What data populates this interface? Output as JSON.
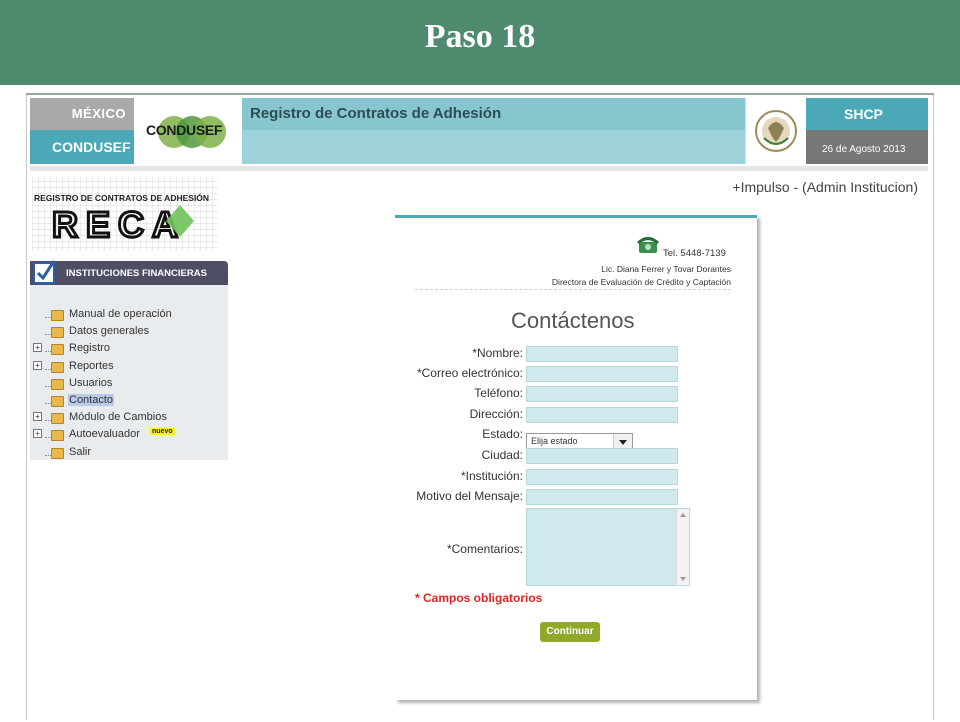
{
  "slide": {
    "title": "Paso 18"
  },
  "banner": {
    "mexico": "MÉXICO",
    "condusef_tab": "CONDUSEF",
    "condusef_logo": "CONDUSEF",
    "title": "Registro de Contratos de Adhesión",
    "shcp": "SHCP",
    "date": "26 de Agosto 2013"
  },
  "user_links": "+Impulso  -  (Admin Institucion)",
  "reca_logo": {
    "caption": "REGISTRO DE CONTRATOS DE ADHESIÓN",
    "word": "RECA"
  },
  "menu": {
    "header": "INSTITUCIONES FINANCIERAS",
    "items": [
      {
        "label": "Manual de operación",
        "expandable": false
      },
      {
        "label": "Datos generales",
        "expandable": false
      },
      {
        "label": "Registro",
        "expandable": true
      },
      {
        "label": "Reportes",
        "expandable": true
      },
      {
        "label": "Usuarios",
        "expandable": false
      },
      {
        "label": "Contacto",
        "expandable": false,
        "selected": true
      },
      {
        "label": "Módulo de Cambios",
        "expandable": true
      },
      {
        "label": "Autoevaluador",
        "expandable": true,
        "badge": "nuevo"
      },
      {
        "label": "Salir",
        "expandable": false
      }
    ]
  },
  "contact": {
    "phone": "Tel. 5448-7139",
    "person": "Lic. Diana Ferrer y Tovar Dorantes",
    "position": "Directora de Evaluación de Crédito y Captación",
    "title": "Contáctenos",
    "labels": {
      "nombre": "*Nombre:",
      "correo": "*Correo electrónico:",
      "telefono": "Teléfono:",
      "direccion": "Dirección:",
      "estado": "Estado:",
      "ciudad": "Ciudad:",
      "institucion": "*Institución:",
      "motivo": "Motivo del Mensaje:",
      "comentarios": "*Comentarios:"
    },
    "estado_selected": "Elija estado",
    "required_note": "* Campos obligatorios",
    "submit": "Continuar"
  },
  "colors": {
    "slide_bar": "#4e8a6e",
    "teal": "#4aa8b7",
    "field_bg": "#cfe9ec",
    "button": "#8fa928",
    "required": "#e02424"
  }
}
